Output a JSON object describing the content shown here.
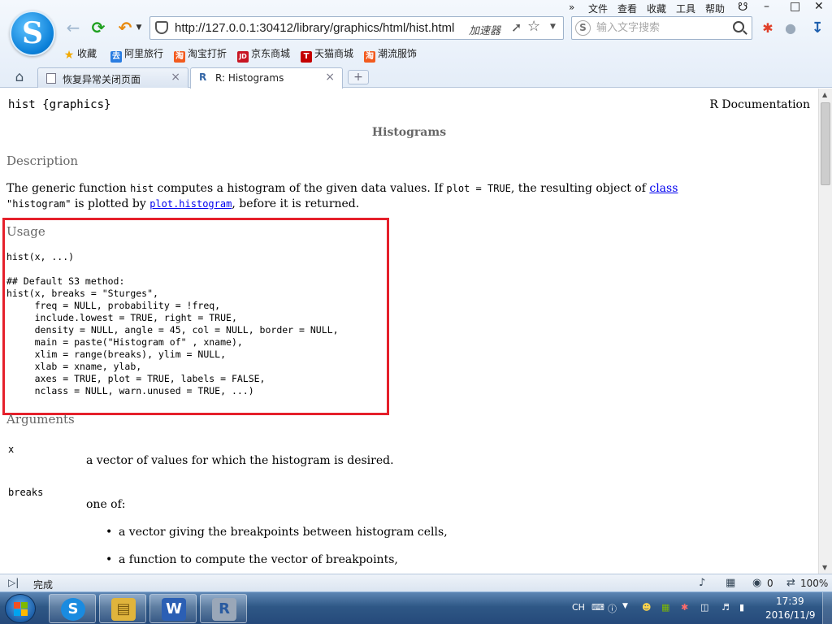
{
  "browser": {
    "logo_glyph": "S",
    "url": "http://127.0.0.1:30412/library/graphics/html/hist.html",
    "accelerator_label": "加速器",
    "search_placeholder": "输入文字搜索",
    "menu": [
      "»",
      "文件",
      "查看",
      "收藏",
      "工具",
      "帮助"
    ],
    "bookmarks": [
      {
        "label": "收藏",
        "icon": "star-icon",
        "color": "#f2a900"
      },
      {
        "label": "阿里旅行",
        "icon": "travel-icon",
        "color": "#2a7de1",
        "glyph": "去"
      },
      {
        "label": "淘宝打折",
        "icon": "taobao-icon",
        "color": "#f25b1f",
        "glyph": "淘"
      },
      {
        "label": "京东商城",
        "icon": "jd-icon",
        "color": "#c81623",
        "glyph": "JD"
      },
      {
        "label": "天猫商城",
        "icon": "tmall-icon",
        "color": "#c40000",
        "glyph": "T"
      },
      {
        "label": "潮流服饰",
        "icon": "fashion-icon",
        "color": "#f25b1f",
        "glyph": "淘"
      }
    ],
    "tabs": [
      {
        "label": "恢复异常关闭页面",
        "icon": "page-icon",
        "active": false
      },
      {
        "label": "R: Histograms",
        "icon": "r-icon",
        "active": true
      }
    ]
  },
  "page": {
    "header_left": "hist {graphics}",
    "header_right": "R Documentation",
    "title": "Histograms",
    "description_heading": "Description",
    "description": {
      "t1": "The generic function ",
      "code1": "hist",
      "t2": " computes a histogram of the given data values. If ",
      "code2": "plot = TRUE",
      "t3": ", the resulting object of ",
      "link1": "class",
      "code3": "\"histogram\"",
      "t4": " is plotted by ",
      "link2": "plot.histogram",
      "t5": ", before it is returned."
    },
    "usage_heading": "Usage",
    "usage_code": "hist(x, ...)\n\n## Default S3 method:\nhist(x, breaks = \"Sturges\",\n     freq = NULL, probability = !freq,\n     include.lowest = TRUE, right = TRUE,\n     density = NULL, angle = 45, col = NULL, border = NULL,\n     main = paste(\"Histogram of\" , xname),\n     xlim = range(breaks), ylim = NULL,\n     xlab = xname, ylab,\n     axes = TRUE, plot = TRUE, labels = FALSE,\n     nclass = NULL, warn.unused = TRUE, ...)",
    "arguments_heading": "Arguments",
    "arguments": [
      {
        "name": "x",
        "desc": "a vector of values for which the histogram is desired."
      },
      {
        "name": "breaks",
        "desc": "one of:"
      }
    ],
    "breaks_bullets": [
      "a vector giving the breakpoints between histogram cells,",
      "a function to compute the vector of breakpoints,"
    ]
  },
  "status": {
    "text": "完成",
    "count": "0",
    "zoom": "100%"
  },
  "taskbar": {
    "apps": [
      {
        "name": "sogou-browser",
        "glyph": "S",
        "color": "#1a8be0"
      },
      {
        "name": "file-explorer",
        "glyph": "▤",
        "color": "#e0b43c"
      },
      {
        "name": "word",
        "glyph": "W",
        "color": "#2b5fb4"
      },
      {
        "name": "r-gui",
        "glyph": "R",
        "color": "#3466a6"
      }
    ],
    "ime": "CH",
    "time": "17:39",
    "date": "2016/11/9"
  },
  "colors": {
    "highlight_box": "#e5202b",
    "link": "#0000ee",
    "heading_gray": "#666666"
  }
}
